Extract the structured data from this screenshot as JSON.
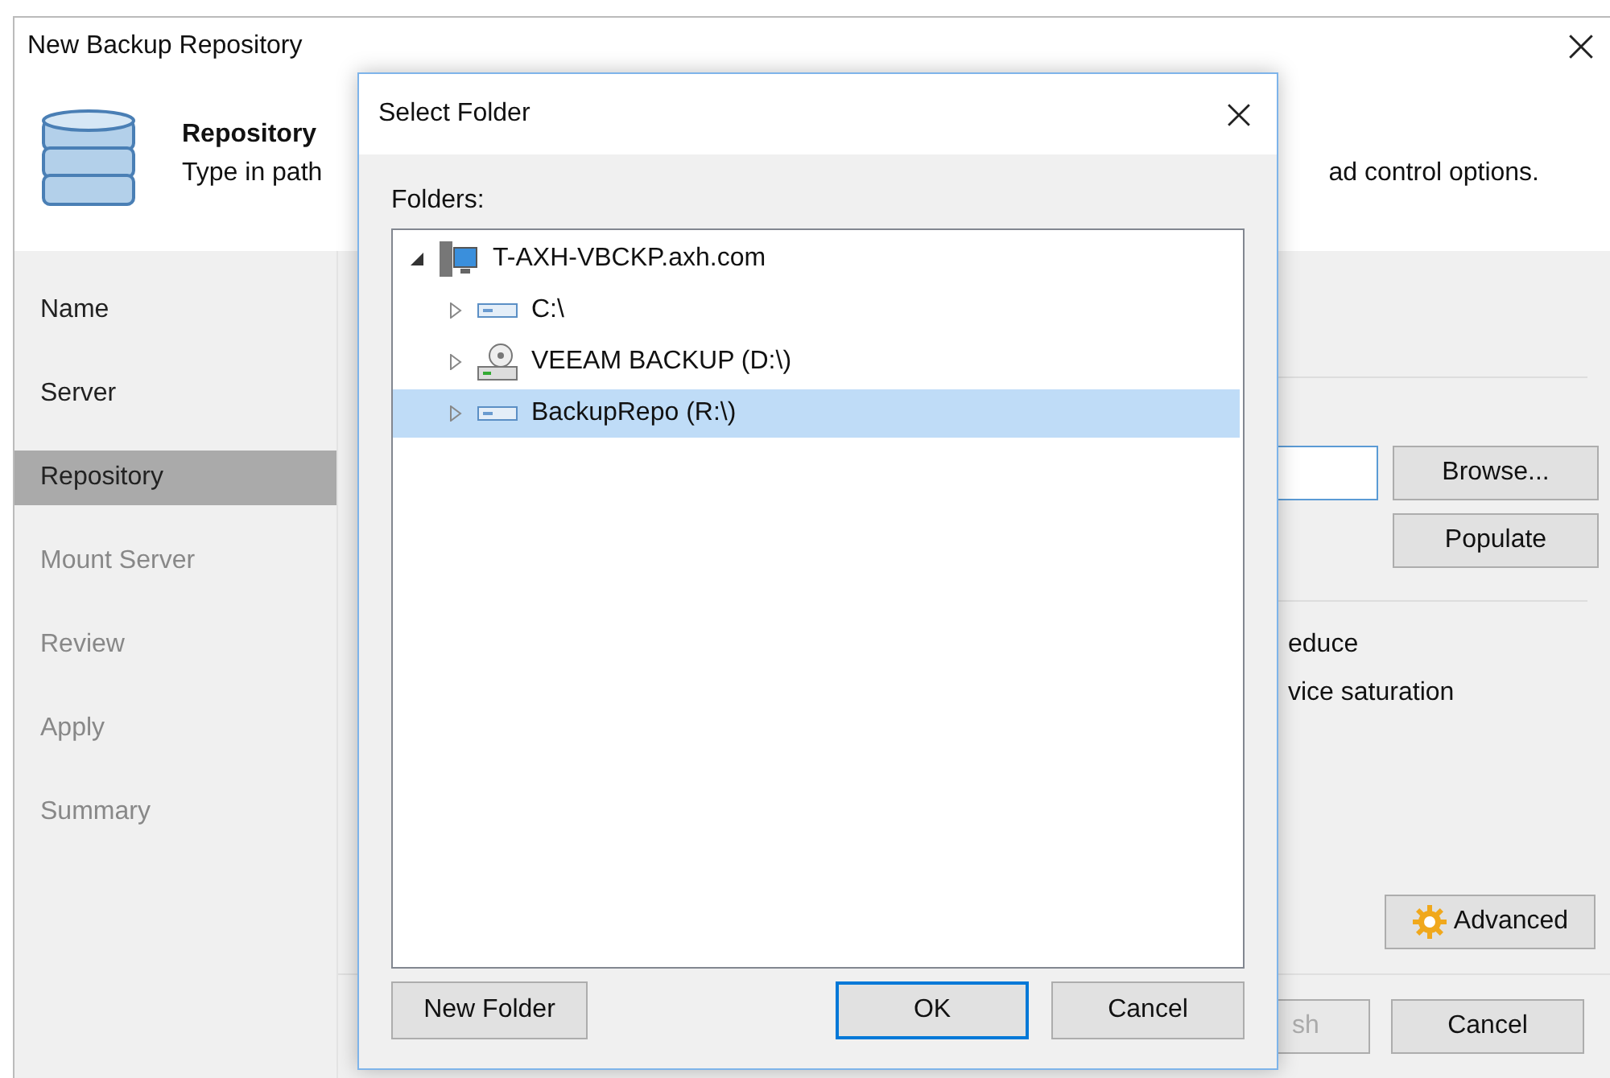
{
  "window": {
    "title": "New Backup Repository"
  },
  "header": {
    "title": "Repository",
    "description_left": "Type in path",
    "description_right": "ad control options."
  },
  "nav": [
    {
      "label": "Name",
      "selected": false,
      "disabled": false
    },
    {
      "label": "Server",
      "selected": false,
      "disabled": false
    },
    {
      "label": "Repository",
      "selected": true,
      "disabled": false
    },
    {
      "label": "Mount Server",
      "selected": false,
      "disabled": true
    },
    {
      "label": "Review",
      "selected": false,
      "disabled": true
    },
    {
      "label": "Apply",
      "selected": false,
      "disabled": true
    },
    {
      "label": "Summary",
      "selected": false,
      "disabled": true
    }
  ],
  "content": {
    "browse_button": "Browse...",
    "populate_button": "Populate",
    "text_1": "educe",
    "text_2": "vice saturation",
    "advanced_button": "Advanced"
  },
  "footer": {
    "finish_button": {
      "label": "sh",
      "disabled": true
    },
    "cancel_button": "Cancel"
  },
  "dialog": {
    "title": "Select Folder",
    "folders_label": "Folders:",
    "tree": [
      {
        "label": "T-AXH-VBCKP.axh.com",
        "kind": "server",
        "expanded": true,
        "selected": false,
        "children": [
          {
            "label": "C:\\",
            "kind": "drive",
            "expanded": false,
            "selected": false
          },
          {
            "label": "VEEAM BACKUP (D:\\)",
            "kind": "backup-drive",
            "expanded": false,
            "selected": false
          },
          {
            "label": "BackupRepo (R:\\)",
            "kind": "drive",
            "expanded": false,
            "selected": true
          }
        ]
      }
    ],
    "buttons": [
      {
        "label": "New Folder",
        "kind": "left",
        "default": false
      },
      {
        "label": "OK",
        "kind": "right",
        "default": true
      },
      {
        "label": "Cancel",
        "kind": "right",
        "default": false
      }
    ]
  }
}
